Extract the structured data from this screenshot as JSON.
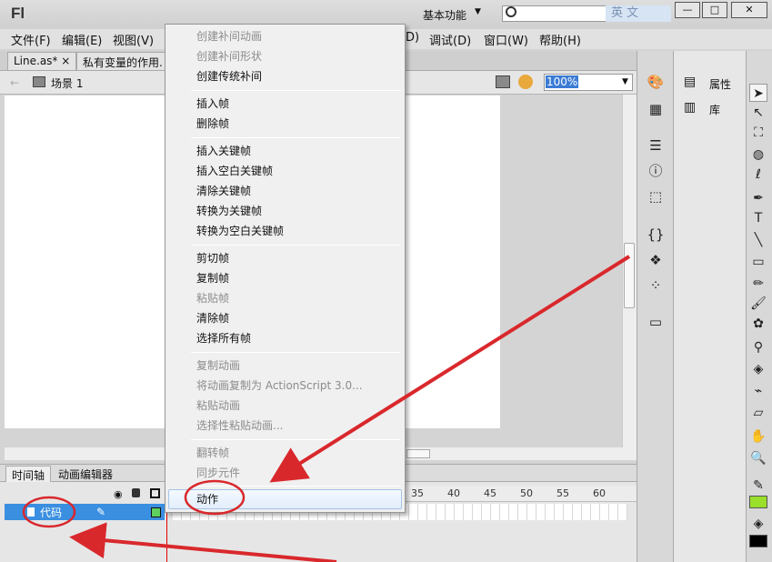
{
  "app": {
    "logo": "Fl",
    "workspace": "基本功能",
    "lang_badge": "英 文"
  },
  "window": {
    "minimize": "—",
    "restore": "□",
    "close": "✕"
  },
  "menubar": [
    "文件(F)",
    "编辑(E)",
    "视图(V)",
    "D)",
    "调试(D)",
    "窗口(W)",
    "帮助(H)"
  ],
  "tabs": [
    {
      "label": "Line.as*",
      "close": "×"
    },
    {
      "label": "私有变量的作用."
    }
  ],
  "scene": {
    "label": "场景 1",
    "zoom": "100%"
  },
  "timeline": {
    "tabs": [
      "时间轴",
      "动画编辑器"
    ],
    "layer": "代码",
    "frame_numbers": [
      "35",
      "40",
      "45",
      "50",
      "55",
      "60"
    ]
  },
  "context_menu": {
    "groups": [
      [
        {
          "label": "创建补间动画",
          "enabled": false
        },
        {
          "label": "创建补间形状",
          "enabled": false
        },
        {
          "label": "创建传统补间",
          "enabled": true
        }
      ],
      [
        {
          "label": "插入帧",
          "enabled": true
        },
        {
          "label": "删除帧",
          "enabled": true
        }
      ],
      [
        {
          "label": "插入关键帧",
          "enabled": true
        },
        {
          "label": "插入空白关键帧",
          "enabled": true
        },
        {
          "label": "清除关键帧",
          "enabled": true
        },
        {
          "label": "转换为关键帧",
          "enabled": true
        },
        {
          "label": "转换为空白关键帧",
          "enabled": true
        }
      ],
      [
        {
          "label": "剪切帧",
          "enabled": true
        },
        {
          "label": "复制帧",
          "enabled": true
        },
        {
          "label": "粘贴帧",
          "enabled": false
        },
        {
          "label": "清除帧",
          "enabled": true
        },
        {
          "label": "选择所有帧",
          "enabled": true
        }
      ],
      [
        {
          "label": "复制动画",
          "enabled": false
        },
        {
          "label": "将动画复制为 ActionScript 3.0...",
          "enabled": false
        },
        {
          "label": "粘贴动画",
          "enabled": false
        },
        {
          "label": "选择性粘贴动画...",
          "enabled": false
        }
      ],
      [
        {
          "label": "翻转帧",
          "enabled": false
        },
        {
          "label": "同步元件",
          "enabled": false
        }
      ],
      [
        {
          "label": "动作",
          "enabled": true,
          "highlighted": true
        }
      ]
    ]
  },
  "right_panel": {
    "properties": "属性",
    "library": "库"
  },
  "colors": {
    "annotation_red": "#d9282c",
    "layer_highlight": "#3a8fe0",
    "fill_swatch": "#9adf2a"
  }
}
